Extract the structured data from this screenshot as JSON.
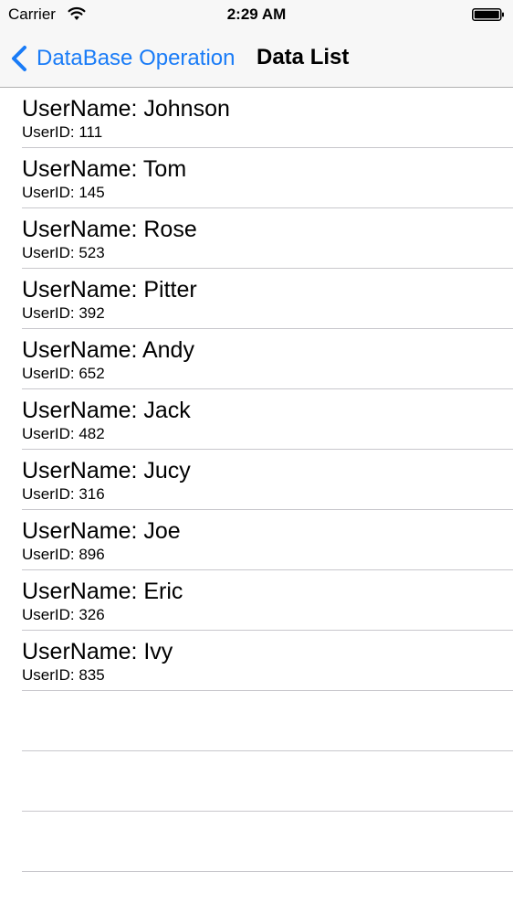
{
  "status_bar": {
    "carrier": "Carrier",
    "time": "2:29 AM",
    "icons": [
      "wifi-icon",
      "battery-icon"
    ]
  },
  "nav": {
    "back_label": "DataBase Operation",
    "title": "Data List",
    "back_icon": "chevron-left-icon",
    "accent_color": "#1a7cf7"
  },
  "list": {
    "rows": [
      {
        "title": "UserName: Johnson",
        "subtitle": "UserID: 111"
      },
      {
        "title": "UserName: Tom",
        "subtitle": "UserID: 145"
      },
      {
        "title": "UserName: Rose",
        "subtitle": "UserID: 523"
      },
      {
        "title": "UserName: Pitter",
        "subtitle": "UserID: 392"
      },
      {
        "title": "UserName: Andy",
        "subtitle": "UserID: 652"
      },
      {
        "title": "UserName: Jack",
        "subtitle": "UserID: 482"
      },
      {
        "title": "UserName: Jucy",
        "subtitle": "UserID: 316"
      },
      {
        "title": "UserName: Joe",
        "subtitle": "UserID: 896"
      },
      {
        "title": "UserName: Eric",
        "subtitle": "UserID: 326"
      },
      {
        "title": "UserName: Ivy",
        "subtitle": "UserID: 835"
      }
    ]
  }
}
